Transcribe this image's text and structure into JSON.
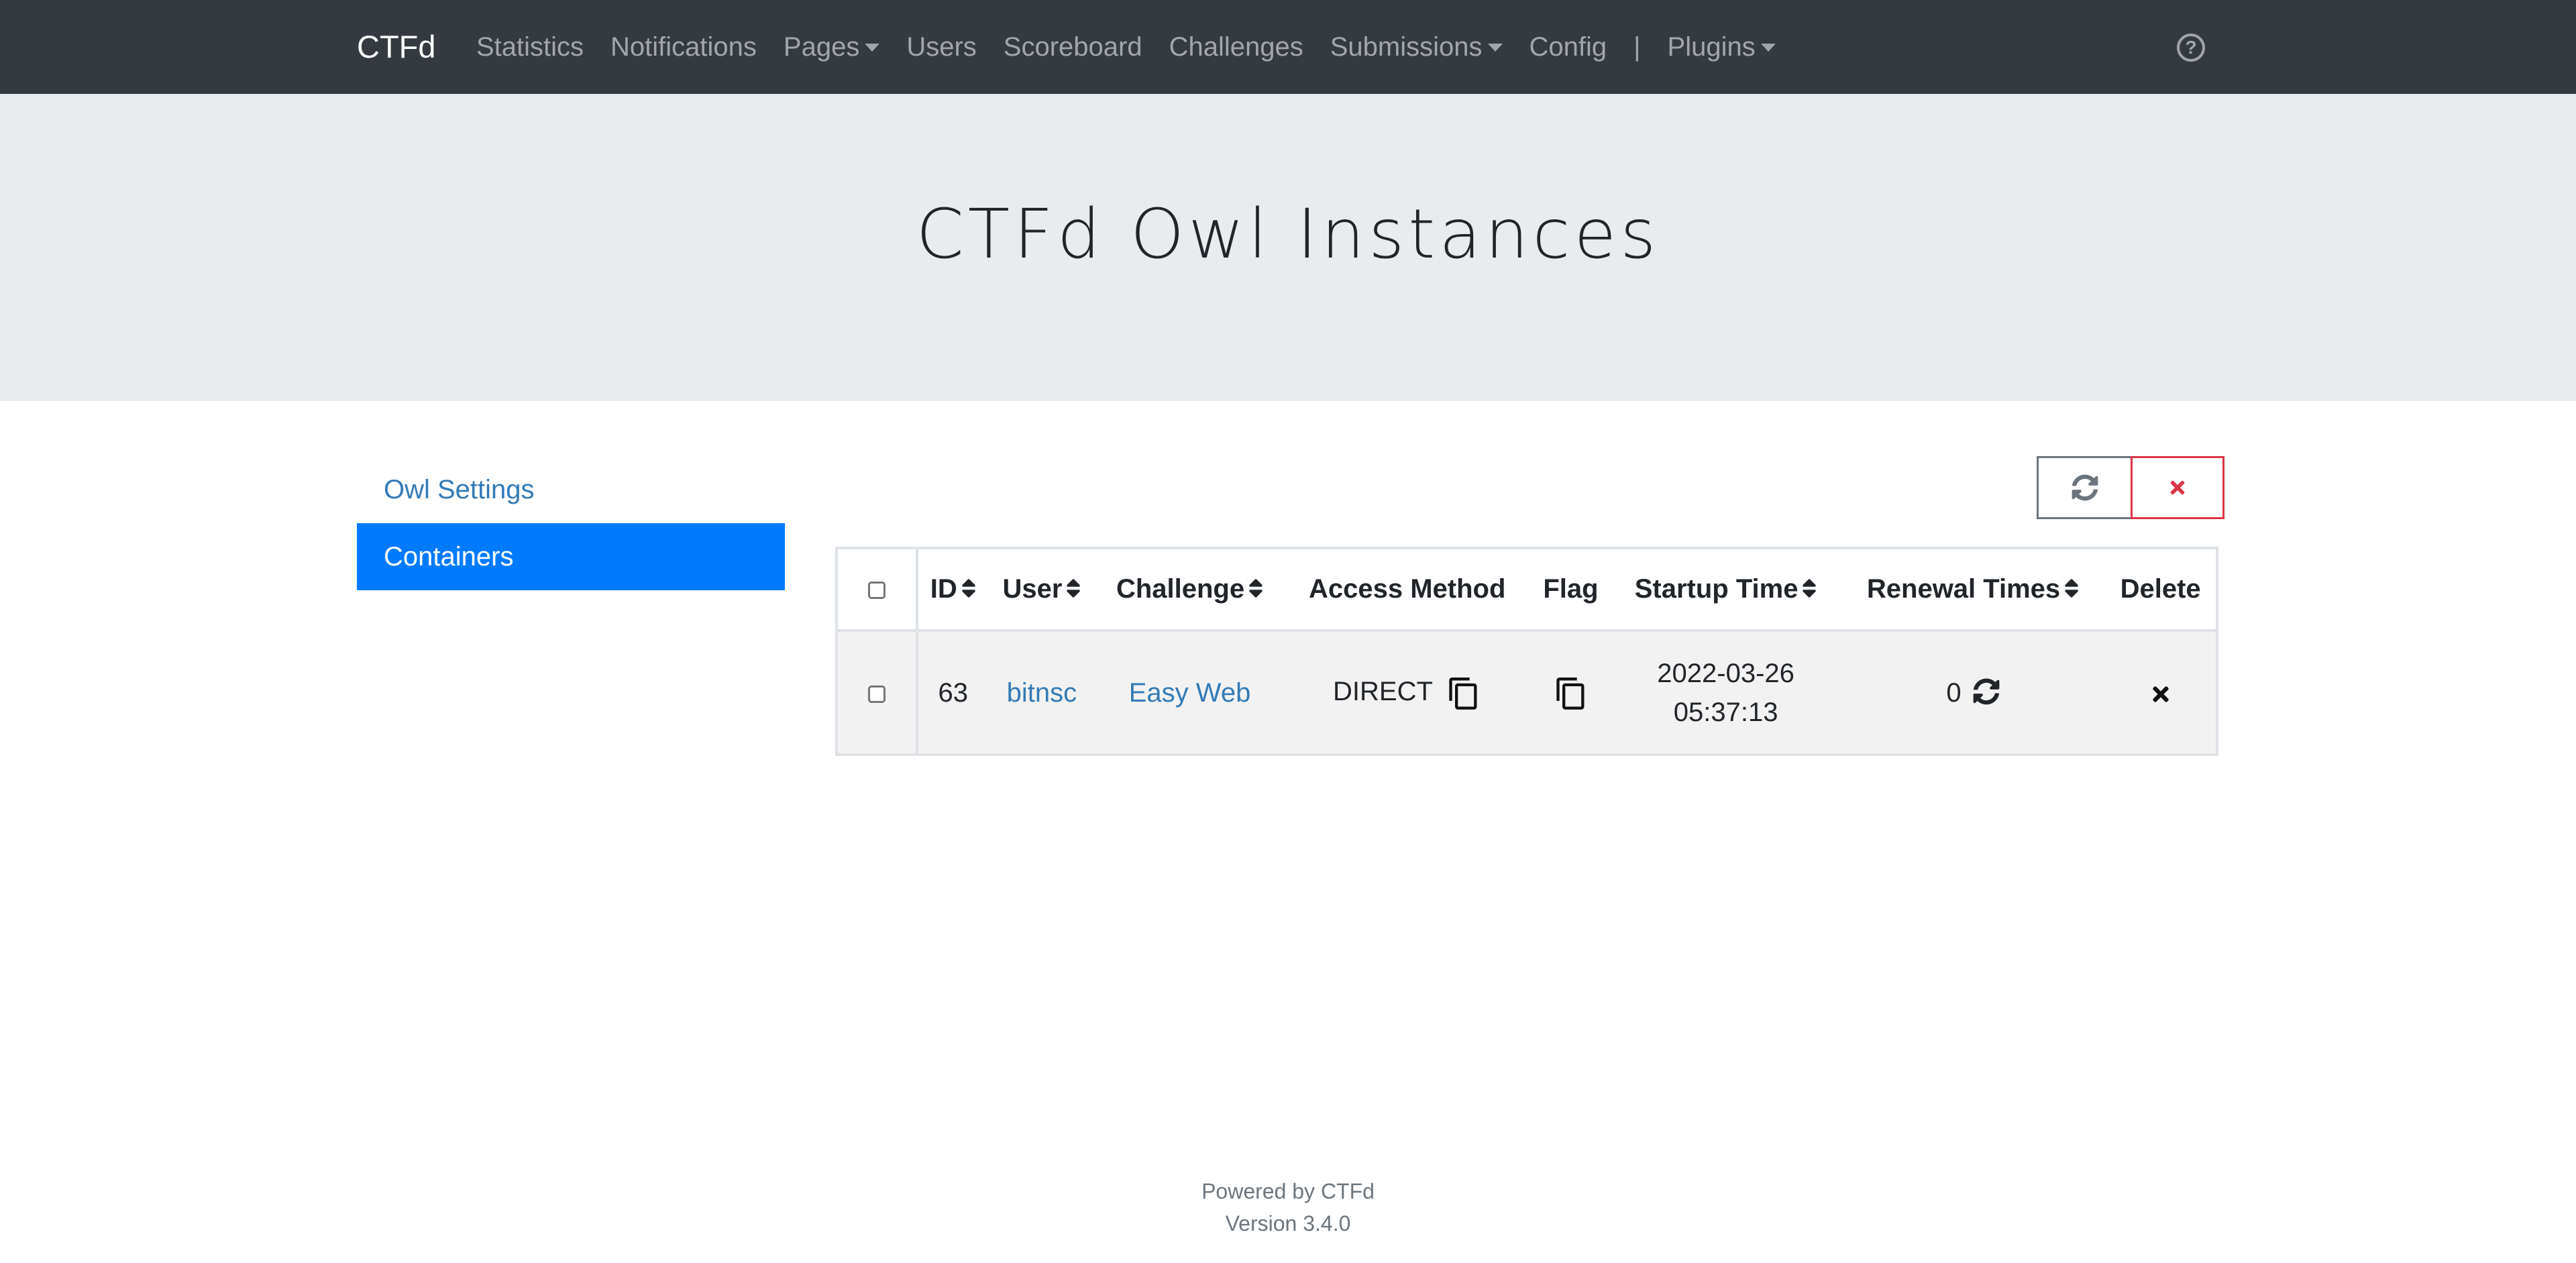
{
  "navbar": {
    "brand": "CTFd",
    "links": [
      {
        "label": "Statistics",
        "dropdown": false
      },
      {
        "label": "Notifications",
        "dropdown": false
      },
      {
        "label": "Pages",
        "dropdown": true
      },
      {
        "label": "Users",
        "dropdown": false
      },
      {
        "label": "Scoreboard",
        "dropdown": false
      },
      {
        "label": "Challenges",
        "dropdown": false
      },
      {
        "label": "Submissions",
        "dropdown": true
      },
      {
        "label": "Config",
        "dropdown": false
      }
    ],
    "separator": "|",
    "plugins": {
      "label": "Plugins",
      "dropdown": true
    },
    "help_icon": "question-circle-icon"
  },
  "header": {
    "title": "CTFd Owl Instances"
  },
  "sidebar": {
    "items": [
      {
        "label": "Owl Settings",
        "active": false
      },
      {
        "label": "Containers",
        "active": true
      }
    ]
  },
  "toolbar": {
    "renew_all_icon": "sync-icon",
    "delete_all_icon": "times-icon",
    "colors": {
      "secondary": "#6c757d",
      "danger": "#dc3545"
    }
  },
  "table": {
    "columns": [
      {
        "label": "ID",
        "sortable": true
      },
      {
        "label": "User",
        "sortable": true
      },
      {
        "label": "Challenge",
        "sortable": true
      },
      {
        "label": "Access Method",
        "sortable": false
      },
      {
        "label": "Flag",
        "sortable": false
      },
      {
        "label": "Startup Time",
        "sortable": true
      },
      {
        "label": "Renewal Times",
        "sortable": true
      },
      {
        "label": "Delete",
        "sortable": false
      }
    ],
    "rows": [
      {
        "id": "63",
        "user": "bitnsc",
        "challenge": "Easy Web",
        "access_method": "DIRECT",
        "startup_date": "2022-03-26",
        "startup_time": "05:37:13",
        "renewal_times": "0"
      }
    ]
  },
  "footer": {
    "powered_by": "Powered by CTFd",
    "version": "Version 3.4.0"
  },
  "colors": {
    "navbar_bg": "#343a40",
    "jumbotron_bg": "#e9ecef",
    "active_bg": "#007bff",
    "link": "#337ab7"
  }
}
